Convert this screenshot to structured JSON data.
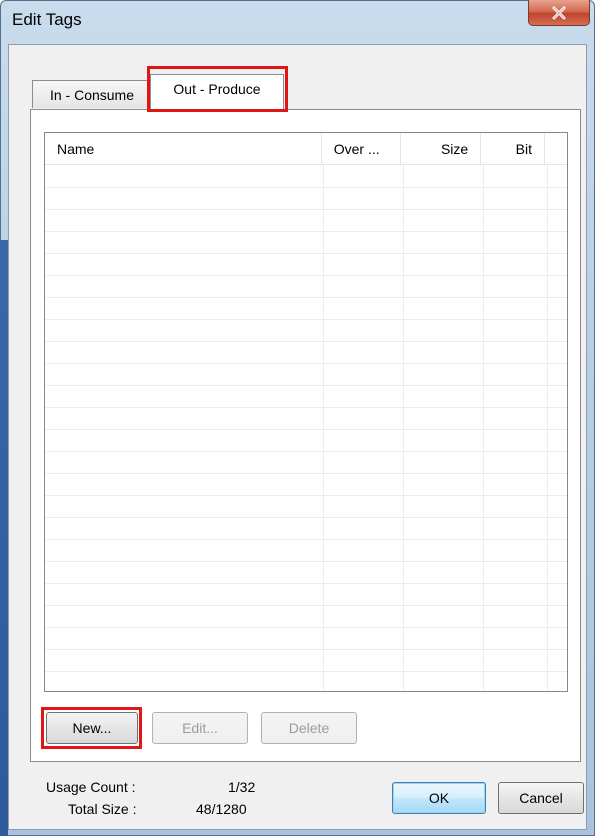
{
  "window": {
    "title": "Edit Tags",
    "close_glyph": "close-icon"
  },
  "tabs": [
    {
      "label": "In - Consume",
      "selected": false
    },
    {
      "label": "Out - Produce",
      "selected": true
    }
  ],
  "list": {
    "columns": [
      "Name",
      "Over ...",
      "Size",
      "Bit"
    ],
    "rows": []
  },
  "buttons": {
    "new": "New...",
    "edit": "Edit...",
    "delete": "Delete",
    "ok": "OK",
    "cancel": "Cancel"
  },
  "status": {
    "usage_label": "Usage Count :",
    "usage_value": "1/32",
    "total_label": "Total Size :",
    "total_value": "48/1280"
  },
  "colors": {
    "highlight": "#e01515"
  }
}
